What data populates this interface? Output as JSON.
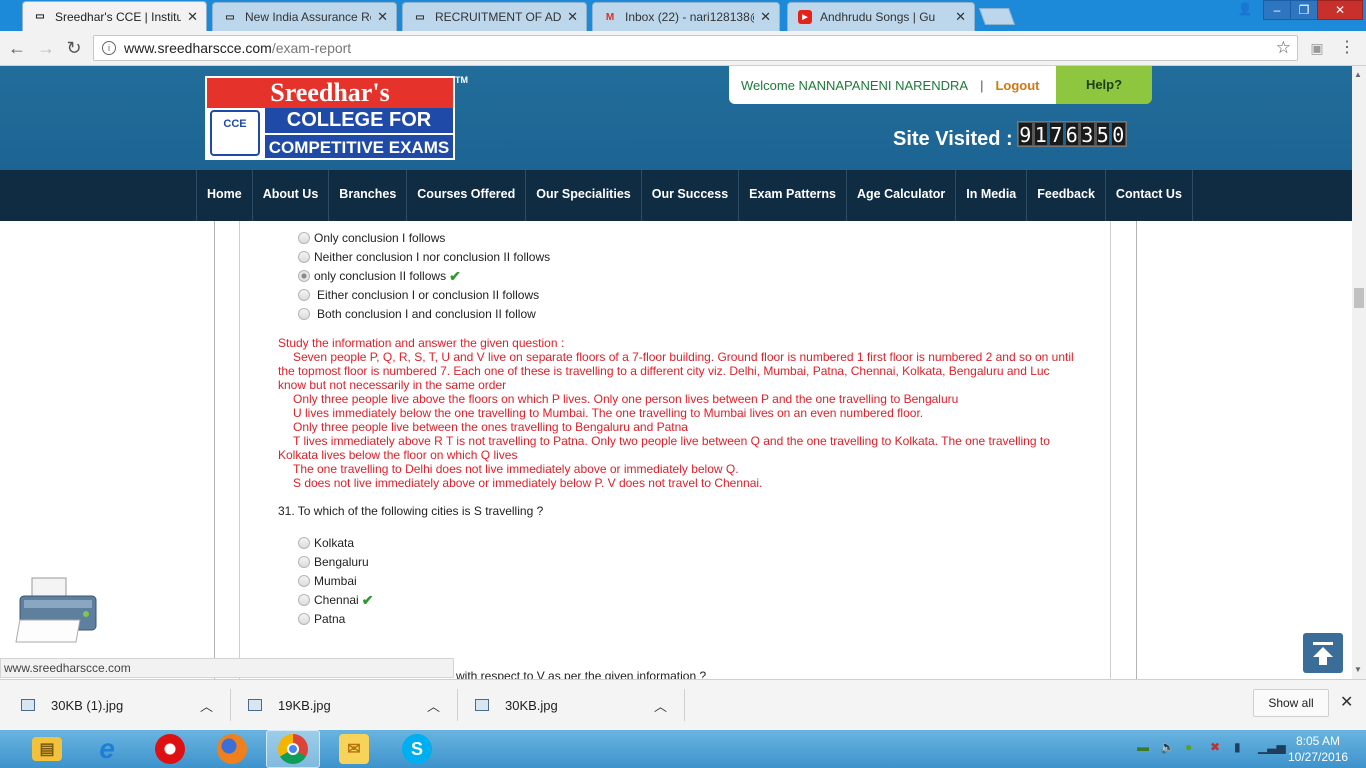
{
  "browser": {
    "tabs": [
      {
        "title": "Sreedhar's CCE | Institute",
        "favicon": "page-icon",
        "active": true
      },
      {
        "title": "New India Assurance Rec",
        "favicon": "page-icon",
        "active": false
      },
      {
        "title": "RECRUITMENT OF ADMI",
        "favicon": "page-icon",
        "active": false
      },
      {
        "title": "Inbox (22) - nari128138@",
        "favicon": "gmail-icon",
        "active": false
      },
      {
        "title": "Andhrudu Songs | Gu",
        "favicon": "youtube-icon",
        "active": false
      }
    ],
    "url_host": "www.sreedharscce.com",
    "url_path": "/exam-report",
    "status_text": "www.sreedharscce.com"
  },
  "site": {
    "logo": {
      "line1": "Sreedhar's",
      "line2": "COLLEGE FOR",
      "line3": "COMPETITIVE EXAMS",
      "badge": "CCE",
      "tm": "TM"
    },
    "welcome": "Welcome NANNAPANENI NARENDRA",
    "separator": "|",
    "logout": "Logout",
    "help": "Help?",
    "visited_label": "Site Visited :",
    "visited_digits": [
      "9",
      "1",
      "7",
      "6",
      "3",
      "5",
      "0"
    ],
    "nav": [
      "Home",
      "About Us",
      "Branches",
      "Courses Offered",
      "Our Specialities",
      "Our Success",
      "Exam Patterns",
      "Age Calculator",
      "In Media",
      "Feedback",
      "Contact Us"
    ]
  },
  "exam": {
    "prev_options": [
      {
        "label": "Only conclusion I follows",
        "correct": false,
        "selected": false
      },
      {
        "label": "Neither conclusion I nor conclusion II follows",
        "correct": false,
        "selected": false
      },
      {
        "label": "only conclusion II follows",
        "correct": true,
        "selected": true
      },
      {
        "label": "Either conclusion I or conclusion II follows",
        "correct": false,
        "selected": false
      },
      {
        "label": "Both conclusion I and conclusion II follow",
        "correct": false,
        "selected": false
      }
    ],
    "passage": [
      "Study the information and answer the given question :",
      "Seven people P, Q, R, S, T, U and V live on separate floors of a 7-floor building. Ground floor is numbered 1 first floor is numbered 2 and so on until the topmost floor is numbered 7. Each one of these is travelling to a different city viz. Delhi, Mumbai, Patna, Chennai, Kolkata, Bengaluru and Luc know but not necessarily in the same order",
      "Only three people live above the floors on which P lives. Only one person lives between P and the one travelling to Bengaluru",
      "U lives immediately below the one travelling to Mumbai. The one travelling to Mumbai lives on an even numbered floor.",
      "Only three people live between the ones travelling to Bengaluru and Patna",
      "T lives immediately above R T is not travelling to Patna. Only two people live between Q and the one travelling to Kolkata. The one travelling to Kolkata lives below the floor on which Q lives",
      "The one travelling to Delhi does not live immediately above or immediately below Q.",
      "S does not live immediately above or immediately below P. V does not travel to Chennai."
    ],
    "question": "31. To which of the following cities is S travelling ?",
    "options": [
      {
        "label": "Kolkata",
        "correct": false
      },
      {
        "label": "Bengaluru",
        "correct": false
      },
      {
        "label": "Mumbai",
        "correct": false
      },
      {
        "label": "Chennai",
        "correct": true
      },
      {
        "label": "Patna",
        "correct": false
      }
    ],
    "check_mark": "✔",
    "next_fragment": "with respect to V as per the given information ?"
  },
  "downloads": {
    "items": [
      "30KB (1).jpg",
      "19KB.jpg",
      "30KB.jpg"
    ],
    "show_all": "Show all"
  },
  "taskbar": {
    "time": "8:05 AM",
    "date": "10/27/2016",
    "apps": [
      "explorer-icon",
      "ie-icon",
      "opera-icon",
      "firefox-icon",
      "chrome-icon",
      "outlook-icon",
      "skype-icon"
    ]
  },
  "colors": {
    "header_blue": "#1e6fa0",
    "nav_dark": "#0f2c43",
    "passage_red": "#e0202a",
    "correct_green": "#2c9a2c",
    "help_green": "#8ec63f",
    "logout_orange": "#d27711"
  }
}
